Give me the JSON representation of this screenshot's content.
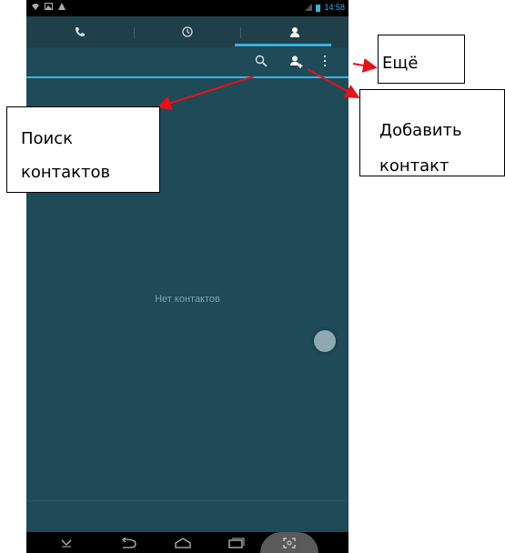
{
  "status_bar": {
    "time": "14:58"
  },
  "tabs": [
    {
      "name": "phone",
      "icon": "phone-icon"
    },
    {
      "name": "recent",
      "icon": "clock-icon"
    },
    {
      "name": "contacts",
      "icon": "contacts-icon",
      "active": true
    }
  ],
  "action_bar": {
    "icons": [
      "search-icon",
      "add-contact-icon",
      "overflow-menu-icon"
    ]
  },
  "empty_state": {
    "text": "Нет контактов"
  },
  "nav_bar": {
    "icons": [
      "hide-keyboard-icon",
      "back-icon",
      "home-icon",
      "recent-apps-icon",
      "screenshot-icon"
    ]
  },
  "callouts": {
    "more": "Ещё",
    "add_contact": {
      "line1": "Добавить",
      "line2": "контакт"
    },
    "search": {
      "line1": "Поиск",
      "line2": "контактов"
    }
  },
  "colors": {
    "accent": "#33b5e5",
    "background": "#1f4a57",
    "arrow": "#e8101a"
  }
}
